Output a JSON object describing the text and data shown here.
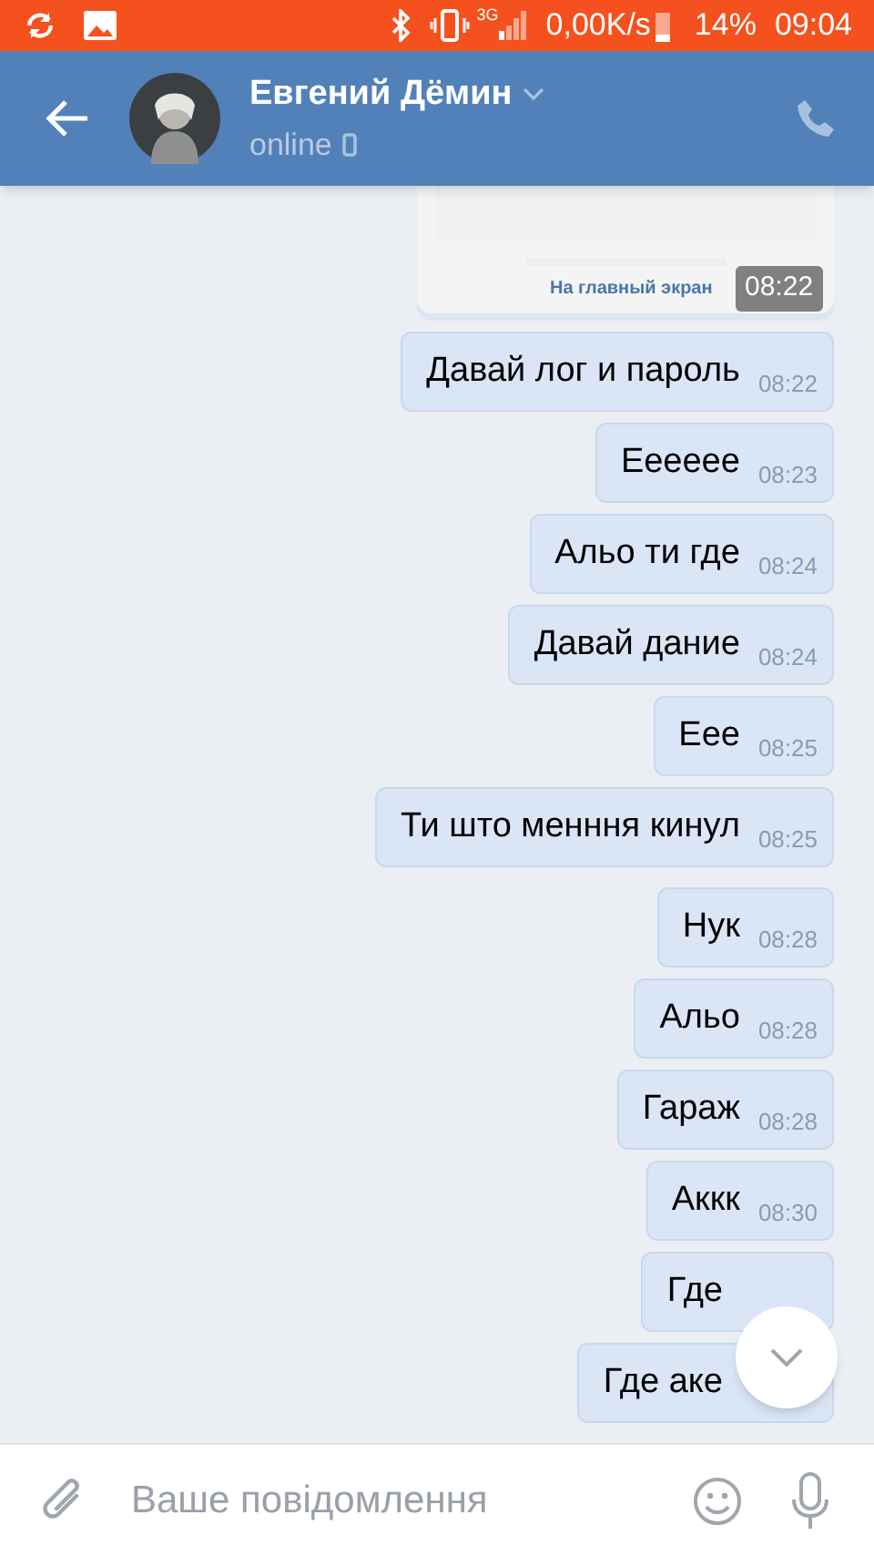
{
  "status_bar": {
    "network": "3G",
    "speed": "0,00K/s",
    "battery": "14%",
    "time": "09:04"
  },
  "header": {
    "name": "Евгений Дёмин",
    "status": "online"
  },
  "attachment": {
    "kind": "picture",
    "link": "На главный экран",
    "time": "08:22"
  },
  "messages": [
    {
      "text": "Давай лог и пароль",
      "time": "08:22"
    },
    {
      "text": "Ееееее",
      "time": "08:23"
    },
    {
      "text": "Альо ти где",
      "time": "08:24"
    },
    {
      "text": "Давай дание",
      "time": "08:24"
    },
    {
      "text": "Еее",
      "time": "08:25"
    },
    {
      "text": "Ти што менння кинул",
      "time": "08:25"
    },
    {
      "text": "Нук",
      "time": "08:28"
    },
    {
      "text": "Альо",
      "time": "08:28"
    },
    {
      "text": "Гараж",
      "time": "08:28"
    },
    {
      "text": "Аккк",
      "time": "08:30"
    },
    {
      "text": "Где"
    },
    {
      "text": "Где аке"
    }
  ],
  "composer": {
    "placeholder": "Ваше повідомлення"
  }
}
